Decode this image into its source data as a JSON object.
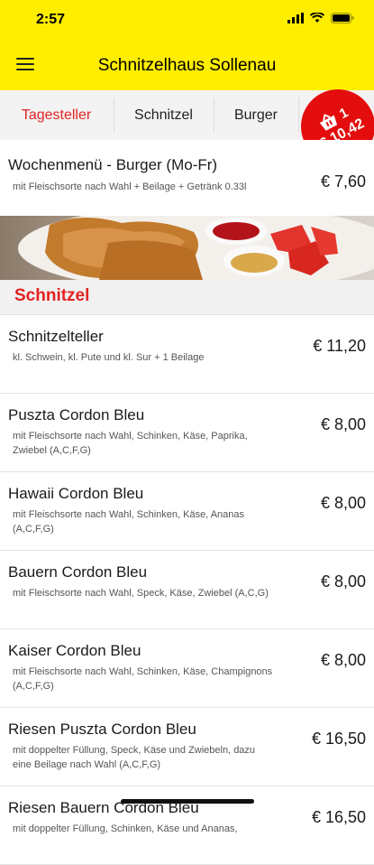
{
  "status": {
    "time": "2:57"
  },
  "header": {
    "title": "Schnitzelhaus Sollenau"
  },
  "tabs": [
    {
      "label": "Tagesteller"
    },
    {
      "label": "Schnitzel"
    },
    {
      "label": "Burger"
    }
  ],
  "cart": {
    "count": "1",
    "total": "€ 10,42"
  },
  "featured": {
    "name": "Wochenmenü - Burger (Mo-Fr)",
    "desc": "mit Fleischsorte nach Wahl + Beilage + Getränk 0.33l",
    "price": "€ 7,60"
  },
  "section": {
    "title": "Schnitzel"
  },
  "items": [
    {
      "name": "Schnitzelteller",
      "desc": "kl. Schwein, kl. Pute und kl. Sur + 1 Beilage",
      "price": "€ 11,20"
    },
    {
      "name": "Puszta Cordon Bleu",
      "desc": "mit Fleischsorte nach Wahl, Schinken, Käse, Paprika, Zwiebel (A,C,F,G)",
      "price": "€ 8,00"
    },
    {
      "name": "Hawaii Cordon Bleu",
      "desc": "mit Fleischsorte nach Wahl, Schinken, Käse, Ananas (A,C,F,G)",
      "price": "€ 8,00"
    },
    {
      "name": "Bauern Cordon Bleu",
      "desc": "mit Fleischsorte nach Wahl, Speck, Käse, Zwiebel (A,C,G)",
      "price": "€ 8,00"
    },
    {
      "name": "Kaiser Cordon Bleu",
      "desc": "mit Fleischsorte nach Wahl, Schinken, Käse, Champignons (A,C,F,G)",
      "price": "€ 8,00"
    },
    {
      "name": "Riesen Puszta Cordon Bleu",
      "desc": "mit doppelter Füllung, Speck, Käse und Zwiebeln, dazu eine Beilage nach Wahl (A,C,F,G)",
      "price": "€ 16,50"
    },
    {
      "name": "Riesen Bauern Cordon Bleu",
      "desc": "mit doppelter Füllung, Schinken, Käse und Ananas,",
      "price": "€ 16,50"
    }
  ],
  "colors": {
    "header": "#ffee00",
    "accent": "#e32222",
    "cart": "#e40d0d"
  },
  "icons": [
    "signal-icon",
    "wifi-icon",
    "battery-icon",
    "menu-icon",
    "basket-icon"
  ]
}
